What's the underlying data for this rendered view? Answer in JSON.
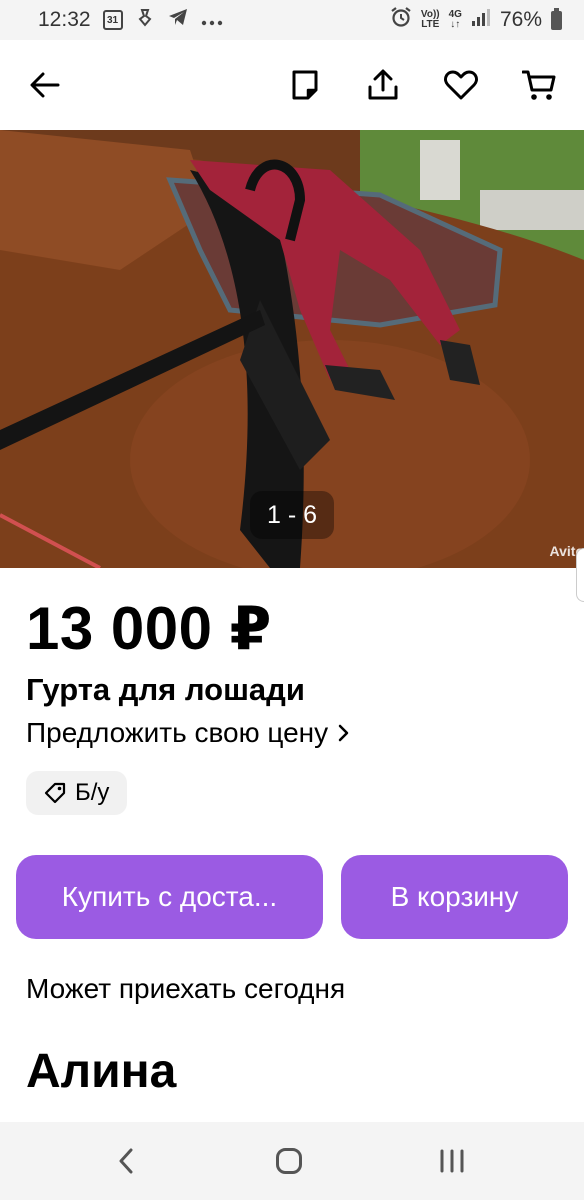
{
  "status_bar": {
    "time": "12:32",
    "calendar_day": "31",
    "volte_top": "Vo))",
    "volte_bottom": "LTE",
    "network_top": "4G",
    "network_bottom": "↓↑",
    "battery": "76%"
  },
  "app_bar": {
    "icons": [
      "back-arrow-icon",
      "note-icon",
      "share-icon",
      "heart-icon",
      "cart-icon"
    ]
  },
  "gallery": {
    "counter": "1 - 6",
    "watermark": "Avito"
  },
  "listing": {
    "price": "13 000 ₽",
    "title": "Гурта для лошади",
    "offer_label": "Предложить свою цену",
    "condition_tag": "Б/у",
    "buy_button": "Купить с доста...",
    "cart_button": "В корзину",
    "delivery_note": "Может приехать сегодня",
    "seller_name": "Алина"
  },
  "colors": {
    "accent": "#9b5be3",
    "tag_bg": "#f1f1f1",
    "system_bar": "#f4f4f4"
  }
}
